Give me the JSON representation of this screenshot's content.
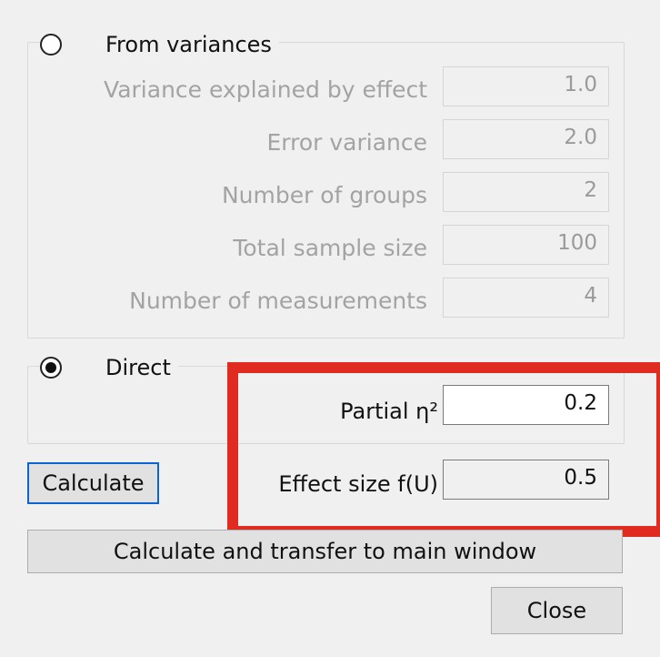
{
  "from_variances": {
    "label": "From variances",
    "selected": false,
    "rows": [
      {
        "label": "Variance explained by effect",
        "value": "1.0"
      },
      {
        "label": "Error variance",
        "value": "2.0"
      },
      {
        "label": "Number of groups",
        "value": "2"
      },
      {
        "label": "Total sample size",
        "value": "100"
      },
      {
        "label": "Number of measurements",
        "value": "4"
      }
    ]
  },
  "direct": {
    "label": "Direct",
    "selected": true,
    "partial_eta_label": "Partial η²",
    "partial_eta_value": "0.2",
    "effect_size_label": "Effect size f(U)",
    "effect_size_value": "0.5"
  },
  "buttons": {
    "calculate": "Calculate",
    "calculate_transfer": "Calculate and transfer to main window",
    "close": "Close"
  },
  "colors": {
    "highlight": "#e02b20",
    "focus_border": "#0a64d8"
  }
}
